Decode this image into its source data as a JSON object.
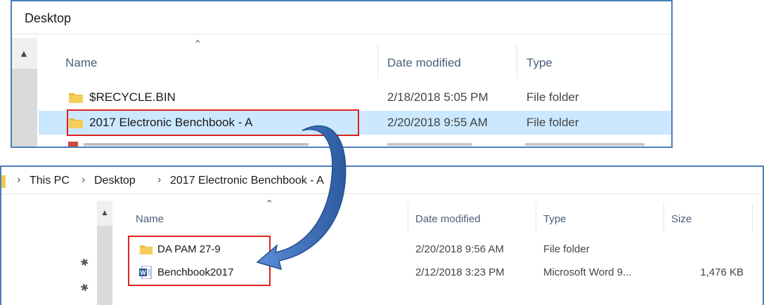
{
  "top": {
    "title": "Desktop",
    "columns": {
      "name": "Name",
      "date": "Date modified",
      "type": "Type"
    },
    "rows": [
      {
        "name": "$RECYCLE.BIN",
        "date": "2/18/2018 5:05 PM",
        "type": "File folder",
        "icon": "folder-icon"
      },
      {
        "name": "2017 Electronic Benchbook - A",
        "date": "2/20/2018 9:55 AM",
        "type": "File folder",
        "icon": "folder-icon"
      }
    ]
  },
  "bottom": {
    "breadcrumb": [
      "This PC",
      "Desktop",
      "2017 Electronic Benchbook - A"
    ],
    "columns": {
      "name": "Name",
      "date": "Date modified",
      "type": "Type",
      "size": "Size"
    },
    "rows": [
      {
        "name": "DA PAM 27-9",
        "date": "2/20/2018 9:56 AM",
        "type": "File folder",
        "size": "",
        "icon": "folder-icon"
      },
      {
        "name": "Benchbook2017",
        "date": "2/12/2018 3:23 PM",
        "type": "Microsoft Word 9...",
        "size": "1,476 KB",
        "icon": "word-doc-icon"
      }
    ]
  },
  "colors": {
    "border": "#4a7ebb",
    "highlight": "#cce8ff",
    "callout": "#e0201e",
    "arrow": "#3d6fb6",
    "folder": "#f3c94f"
  }
}
